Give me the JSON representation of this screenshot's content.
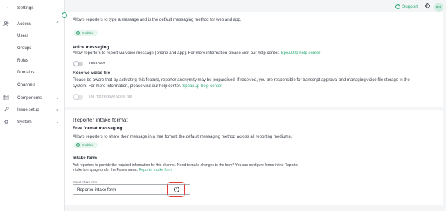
{
  "sidebar": {
    "back_label": "Settings",
    "items": [
      {
        "label": "Access",
        "icon": "users-icon"
      },
      {
        "label": "Components",
        "icon": "database-icon"
      },
      {
        "label": "Issue setup",
        "icon": "wrench-icon"
      },
      {
        "label": "System",
        "icon": "gear-icon"
      }
    ],
    "access_children": [
      "Users",
      "Groups",
      "Roles",
      "Domains",
      "Channels"
    ]
  },
  "topbar": {
    "support_label": "Support",
    "avatar_initials": "KD"
  },
  "written": {
    "description": "Allows reporters to type a message and is the default messaging method for web and app.",
    "badge": "Enabled"
  },
  "voice": {
    "title": "Voice messaging",
    "description": "Allow reporters to report via voice message (phone and app). For more information please visit our help center.",
    "link": "SpeakUp help center",
    "toggle_label": "Disabled"
  },
  "voice_file": {
    "title": "Receive voice file",
    "description_line1": "Please be aware that by activating this feature, reporter anonymity may be jeopardised. If received, you are responsible for transcript approval and managing voice file storage in the",
    "description_line2": "system. For more information, please visit our help center.",
    "link": "SpeakUp help center",
    "toggle_label": "Do not receive voice file"
  },
  "intake": {
    "section_title": "Reporter intake format",
    "free_title": "Free format messaging",
    "free_description": "Allows reporters to share their message in a free format, the default messaging method across all reporting mediums.",
    "free_badge": "Enabled",
    "form_title": "Intake form",
    "form_description_line1": "Ask reporters to provide the required information for this channel. Need to make changes to the form? You can configure forms in the Reporter",
    "form_description_line2": "intake form page under the Forms menu.",
    "form_link": "Reporter intake form",
    "select_label": "Select intake form",
    "select_value": "Reporter intake form"
  },
  "colors": {
    "accent": "#2eaa76",
    "highlight": "#e03b3b"
  }
}
